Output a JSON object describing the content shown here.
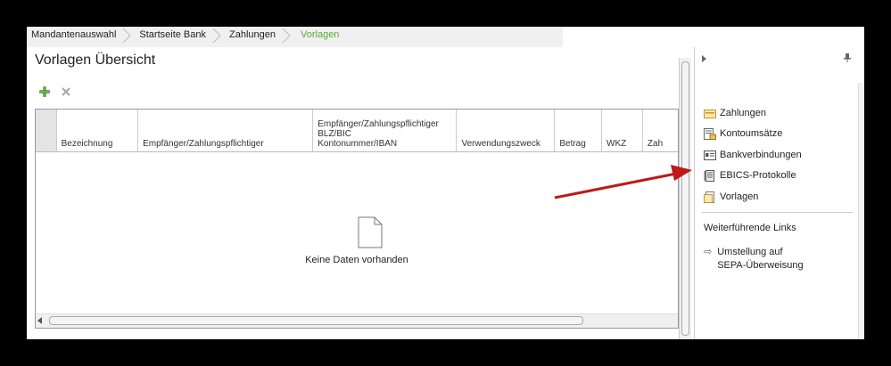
{
  "breadcrumb": [
    {
      "label": "Mandantenauswahl",
      "active": false
    },
    {
      "label": "Startseite Bank",
      "active": false
    },
    {
      "label": "Zahlungen",
      "active": false
    },
    {
      "label": "Vorlagen",
      "active": true
    }
  ],
  "page": {
    "title": "Vorlagen Übersicht"
  },
  "toolbar": {
    "add_icon": "plus-icon",
    "delete_icon": "x-icon"
  },
  "grid": {
    "columns": [
      {
        "label": ""
      },
      {
        "label": "Bezeichnung"
      },
      {
        "label": "Empfänger/Zahlungspflichtiger"
      },
      {
        "label": "Empfänger/Zahlungspflichtiger\nBLZ/BIC\nKontonummer/IBAN"
      },
      {
        "label": "Verwendungszweck"
      },
      {
        "label": "Betrag"
      },
      {
        "label": "WKZ"
      },
      {
        "label": "Zah"
      }
    ],
    "empty_text": "Keine Daten vorhanden"
  },
  "right_panel": {
    "items": [
      {
        "label": "Zahlungen",
        "icon": "zahlungen-icon"
      },
      {
        "label": "Kontoumsätze",
        "icon": "kontoumsaetze-icon"
      },
      {
        "label": "Bankverbindungen",
        "icon": "bankverbindungen-icon"
      },
      {
        "label": "EBICS-Protokolle",
        "icon": "ebics-protokolle-icon"
      },
      {
        "label": "Vorlagen",
        "icon": "vorlagen-icon"
      }
    ],
    "section_title": "Weiterführende Links",
    "link": {
      "label": "Umstellung auf\nSEPA-Überweisung"
    }
  },
  "colors": {
    "accent": "#5aab3c",
    "arrow": "#d42020"
  }
}
